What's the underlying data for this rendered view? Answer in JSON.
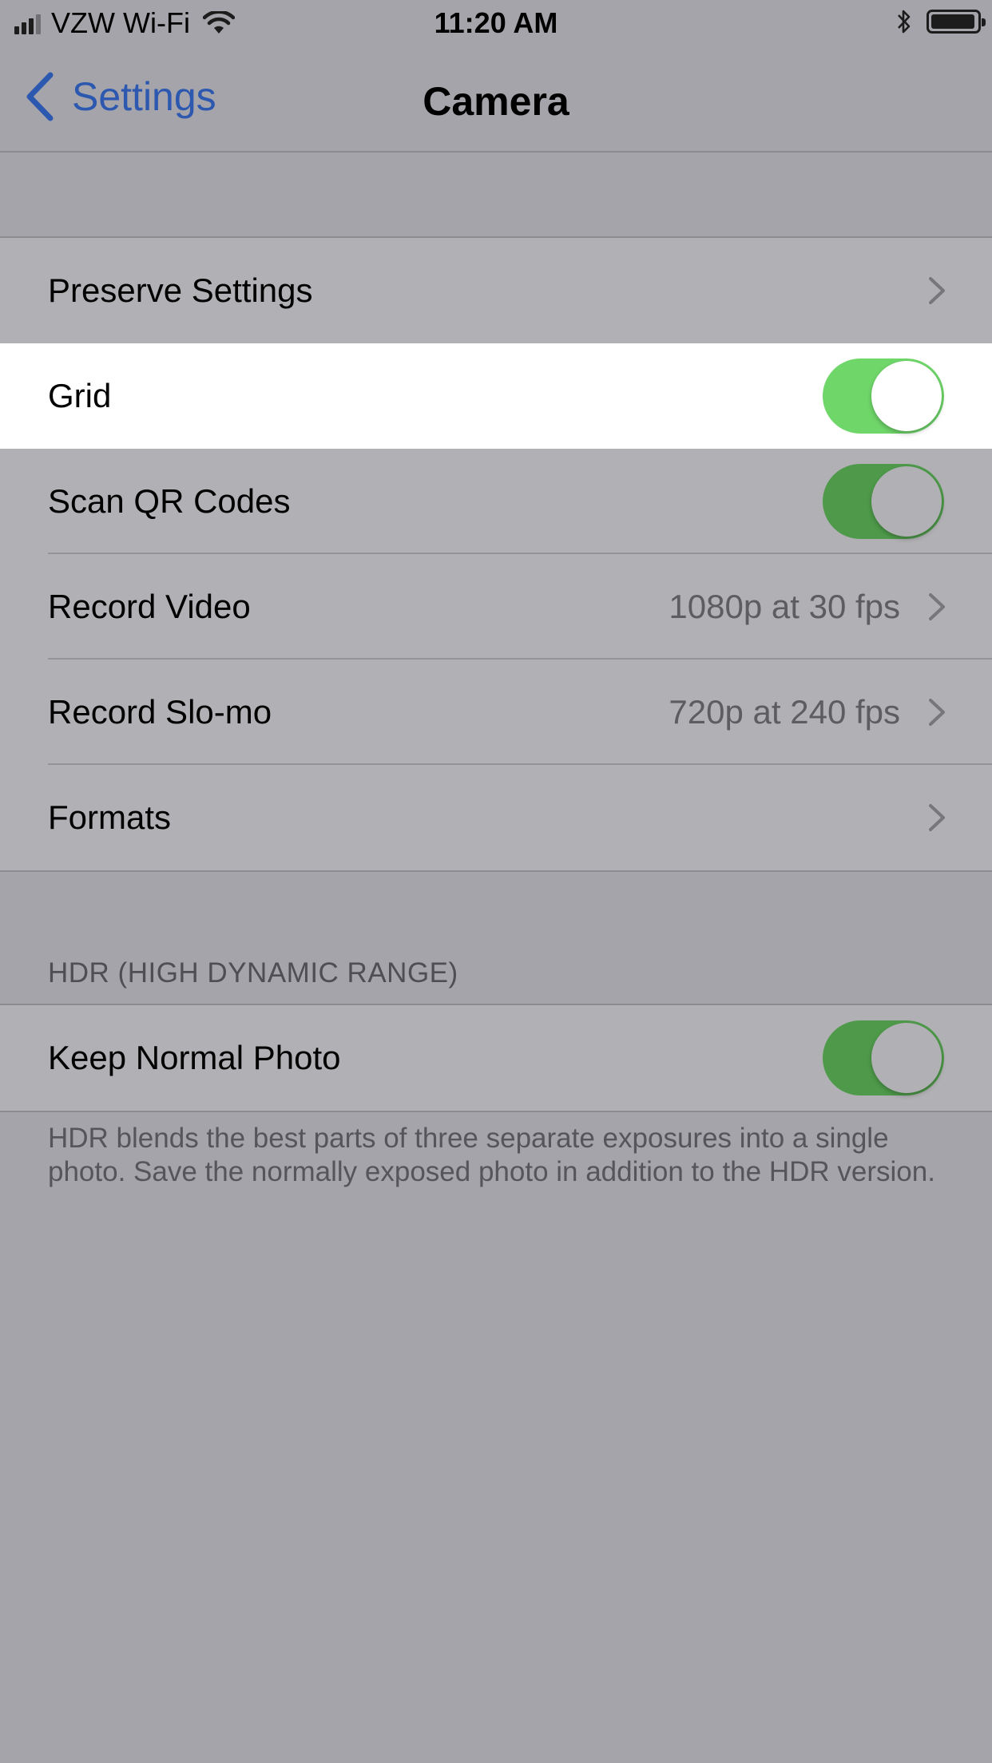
{
  "status_bar": {
    "carrier": "VZW Wi-Fi",
    "time": "11:20 AM",
    "signal_icon": "cellular-signal-icon",
    "wifi_icon": "wifi-icon",
    "bluetooth_icon": "bluetooth-icon",
    "battery_icon": "battery-icon"
  },
  "nav": {
    "back_label": "Settings",
    "title": "Camera"
  },
  "group1": {
    "rows": [
      {
        "label": "Preserve Settings",
        "type": "disclosure"
      },
      {
        "label": "Grid",
        "type": "toggle",
        "on": true,
        "highlighted": true
      },
      {
        "label": "Scan QR Codes",
        "type": "toggle",
        "on": true
      },
      {
        "label": "Record Video",
        "type": "disclosure",
        "value": "1080p at 30 fps"
      },
      {
        "label": "Record Slo-mo",
        "type": "disclosure",
        "value": "720p at 240 fps"
      },
      {
        "label": "Formats",
        "type": "disclosure"
      }
    ]
  },
  "hdr": {
    "header": "HDR (HIGH DYNAMIC RANGE)",
    "rows": [
      {
        "label": "Keep Normal Photo",
        "type": "toggle",
        "on": true
      }
    ],
    "footer": "HDR blends the best parts of three separate exposures into a single photo. Save the normally exposed photo in addition to the HDR version."
  },
  "colors": {
    "accent": "#2c58b0",
    "toggle_on_dimmed": "#4e9a4a",
    "toggle_on_bright": "#6fd66a",
    "background": "#a5a4aa",
    "cell_background": "#b1b0b4"
  }
}
